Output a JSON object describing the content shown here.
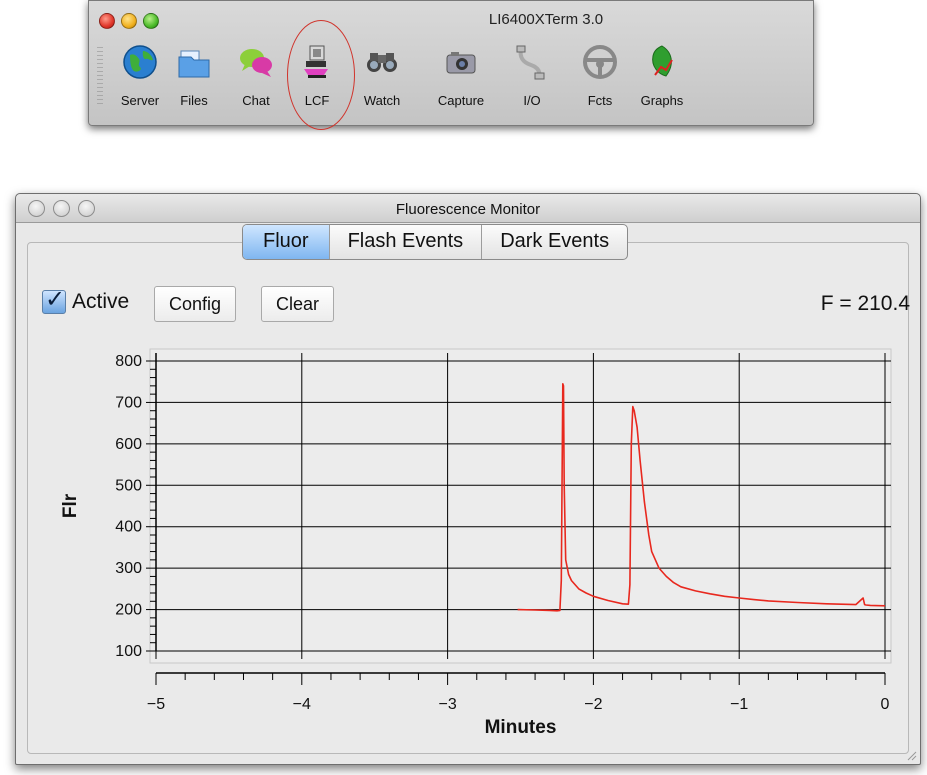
{
  "toolbar_window": {
    "title": "LI6400XTerm 3.0",
    "tools": [
      {
        "label": "Server",
        "icon": "globe-icon"
      },
      {
        "label": "Files",
        "icon": "folder-icon"
      },
      {
        "label": "Chat",
        "icon": "chat-bubbles-icon"
      },
      {
        "label": "LCF",
        "icon": "lcf-chamber-icon"
      },
      {
        "label": "Watch",
        "icon": "binoculars-icon"
      },
      {
        "label": "Capture",
        "icon": "camera-icon"
      },
      {
        "label": "I/O",
        "icon": "cable-icon"
      },
      {
        "label": "Fcts",
        "icon": "steering-wheel-icon"
      },
      {
        "label": "Graphs",
        "icon": "leaf-graph-icon"
      }
    ],
    "highlight_color": "#d0342c"
  },
  "monitor_window": {
    "title": "Fluorescence Monitor",
    "tabs": [
      {
        "label": "Fluor",
        "active": true
      },
      {
        "label": "Flash Events",
        "active": false
      },
      {
        "label": "Dark Events",
        "active": false
      }
    ],
    "active_label": "Active",
    "active_checked": true,
    "config_label": "Config",
    "clear_label": "Clear",
    "f_value": "F = 210.4"
  },
  "chart_data": {
    "type": "line",
    "xlabel": "Minutes",
    "ylabel": "Flr",
    "xlim": [
      -5,
      0
    ],
    "ylim": [
      100,
      800
    ],
    "x_ticks": [
      -5,
      -4,
      -3,
      -2,
      -1,
      0
    ],
    "y_ticks": [
      100,
      200,
      300,
      400,
      500,
      600,
      700,
      800
    ],
    "grid": true,
    "series": [
      {
        "color": "#e8281e",
        "x": [
          -2.52,
          -2.4,
          -2.3,
          -2.25,
          -2.23,
          -2.22,
          -2.21,
          -2.205,
          -2.2,
          -2.19,
          -2.17,
          -2.15,
          -2.1,
          -2.05,
          -2.0,
          -1.9,
          -1.8,
          -1.76,
          -1.75,
          -1.74,
          -1.73,
          -1.72,
          -1.7,
          -1.68,
          -1.65,
          -1.62,
          -1.6,
          -1.55,
          -1.5,
          -1.45,
          -1.4,
          -1.3,
          -1.2,
          -1.1,
          -1.0,
          -0.9,
          -0.8,
          -0.6,
          -0.4,
          -0.2,
          -0.15,
          -0.14,
          -0.13,
          -0.1,
          0.0
        ],
        "values": [
          200,
          199,
          198,
          197,
          198,
          270,
          745,
          740,
          500,
          320,
          285,
          270,
          250,
          240,
          232,
          222,
          214,
          213,
          260,
          600,
          690,
          680,
          640,
          560,
          460,
          380,
          340,
          300,
          280,
          265,
          255,
          245,
          238,
          232,
          228,
          224,
          221,
          217,
          214,
          212,
          228,
          212,
          211,
          210,
          209
        ]
      }
    ]
  }
}
